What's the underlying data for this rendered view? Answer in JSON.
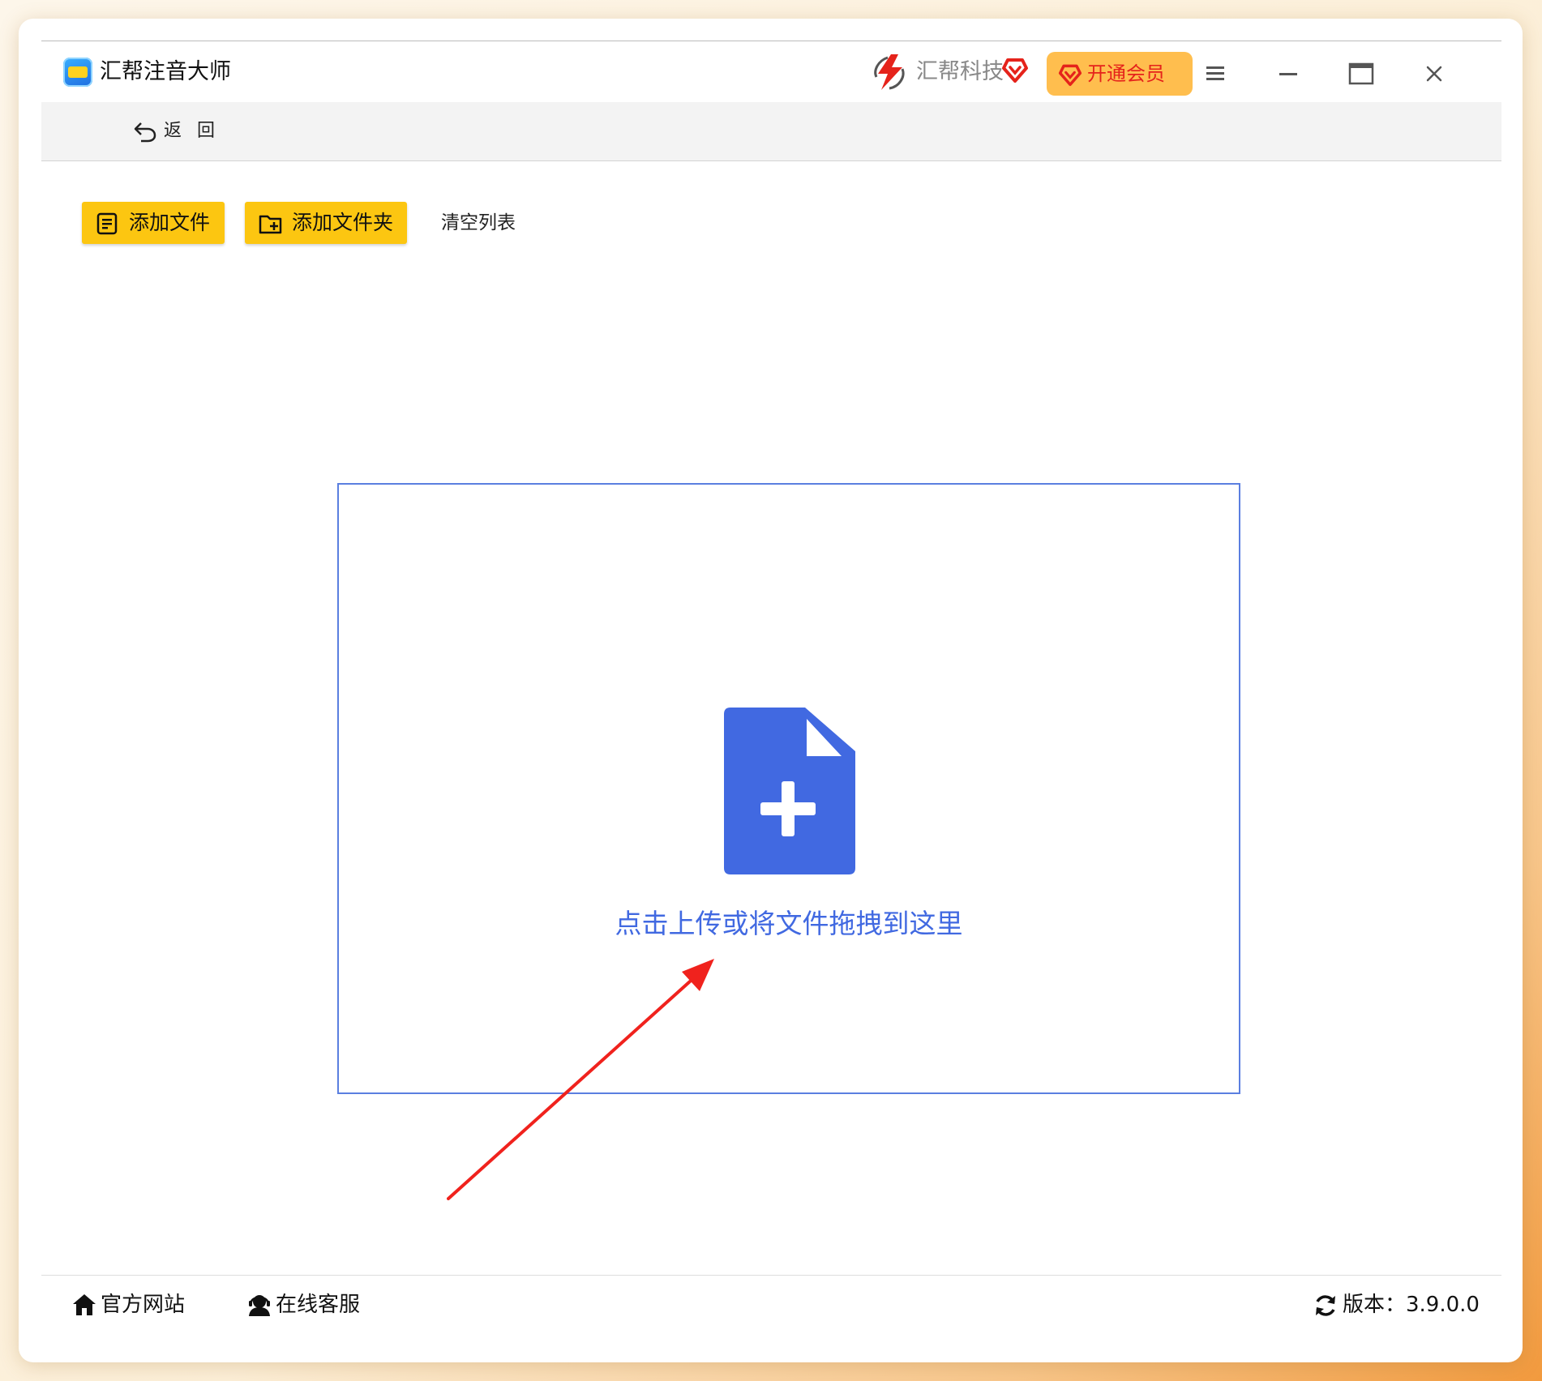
{
  "window": {
    "app_title": "汇帮注音大师",
    "brand_name": "汇帮科技",
    "vip_label": "开通会员"
  },
  "nav": {
    "back_label": "返 回"
  },
  "toolbar": {
    "add_file_label": "添加文件",
    "add_folder_label": "添加文件夹",
    "clear_list_label": "清空列表"
  },
  "dropzone": {
    "hint": "点击上传或将文件拖拽到这里"
  },
  "footer": {
    "website_label": "官方网站",
    "service_label": "在线客服",
    "version_label": "版本：3.9.0.0"
  },
  "colors": {
    "accent_yellow": "#fcc611",
    "vip_orange": "#ffbe4e",
    "vip_red": "#e5231b",
    "drop_blue": "#4169e1",
    "annotation_red": "#f0221d"
  },
  "icons": [
    "app-logo",
    "brand-logo-icon",
    "heart-gem-icon",
    "menu-icon",
    "minimize-icon",
    "maximize-icon",
    "close-icon",
    "back-arrow-icon",
    "file-list-icon",
    "folder-add-icon",
    "file-add-icon",
    "home-icon",
    "headset-user-icon",
    "refresh-icon",
    "annotation-arrow"
  ]
}
